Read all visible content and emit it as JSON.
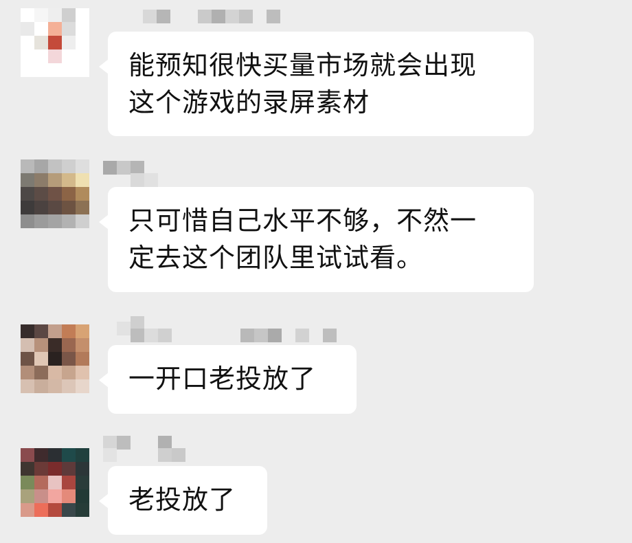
{
  "chat": {
    "messages": [
      {
        "sender_avatar_colors": [
          "#ffffff",
          "#f6f6f6",
          "#eeeeee",
          "#cfcfcf",
          "#ffffff",
          "#e9e9e9",
          "#ffffff",
          "#f4b097",
          "#dcdcdc",
          "#ffffff",
          "#ffffff",
          "#e6e3dc",
          "#c44a3a",
          "#eeeeee",
          "#ffffff",
          "#ffffff",
          "#ffffff",
          "#f3d7da",
          "#ffffff",
          "#ffffff",
          "#ffffff",
          "#ffffff",
          "#ffffff",
          "#ffffff",
          "#ffffff"
        ],
        "text": "能预知很快买量市场就会出现\n这个游戏的录屏素材"
      },
      {
        "sender_avatar_colors": [
          "#b9b9b9",
          "#a7a7a7",
          "#c2c2c2",
          "#cfcfcf",
          "#dedede",
          "#7d7a72",
          "#8c7c6a",
          "#b59c7a",
          "#d3b98b",
          "#efe0b1",
          "#4d4846",
          "#5c4c46",
          "#6f5246",
          "#8c6446",
          "#b08b5c",
          "#3e3b3b",
          "#4b4240",
          "#5a4943",
          "#6d5342",
          "#8c7154",
          "#8e8e8e",
          "#9b9b9b",
          "#a4a4a4",
          "#b2b2b2",
          "#cfcfcf"
        ],
        "text": "只可惜自己水平不够，不然一\n定去这个团队里试试看。"
      },
      {
        "sender_avatar_colors": [
          "#362c2b",
          "#5b4743",
          "#c29f8c",
          "#c27d56",
          "#d8a374",
          "#d4beb1",
          "#b7917b",
          "#3a2c28",
          "#9a6750",
          "#c48f6c",
          "#6e5346",
          "#e0c7b5",
          "#2a2220",
          "#7a5648",
          "#b27a5a",
          "#b28e79",
          "#8c6c5a",
          "#d8b9a5",
          "#c7a58e",
          "#e0c2ae",
          "#d7c0b1",
          "#c9ae9c",
          "#d3b8a6",
          "#dcc6b8",
          "#e7d6cb"
        ],
        "text": "一开口老投放了"
      },
      {
        "sender_avatar_colors": [
          "#8a4b4e",
          "#3f2b2d",
          "#2b2f33",
          "#1f4a4a",
          "#20403e",
          "#3f3530",
          "#6b3a37",
          "#7a2c2c",
          "#5e3a3a",
          "#2c3638",
          "#7a8a5a",
          "#b46a5c",
          "#e8c3c2",
          "#a9463f",
          "#2a3c3a",
          "#a9a27c",
          "#c98f8a",
          "#f2a6a0",
          "#e48a7a",
          "#223a36",
          "#d99a8a",
          "#ec6e5a",
          "#b44a3e",
          "#39474a",
          "#263c38"
        ],
        "text": "老投放了"
      }
    ],
    "name_blur_colors": [
      [
        "#d8d8d8",
        "#b6b6b6",
        "#cacaca",
        "#b0b0b0",
        "#d3d3d3",
        "#c4c4c4",
        "#bdbdbd"
      ],
      [
        "#a9a9a9",
        "#c8c8c8",
        "#b5b5b5",
        "#d9d9d9",
        "#e1e1e1"
      ],
      [
        "#e2e2e2",
        "#cfcfcf",
        "#bdbdbd",
        "#dcdcdc",
        "#d0d0d0",
        "#b9b9b9",
        "#c6c6c6",
        "#aaaaaa",
        "#d2d2d2",
        "#bebebe"
      ],
      [
        "#d6d6d6",
        "#bdbdbd",
        "#e3e3e3",
        "#b1b1b1",
        "#cfcfcf",
        "#c9c9c9"
      ]
    ]
  }
}
